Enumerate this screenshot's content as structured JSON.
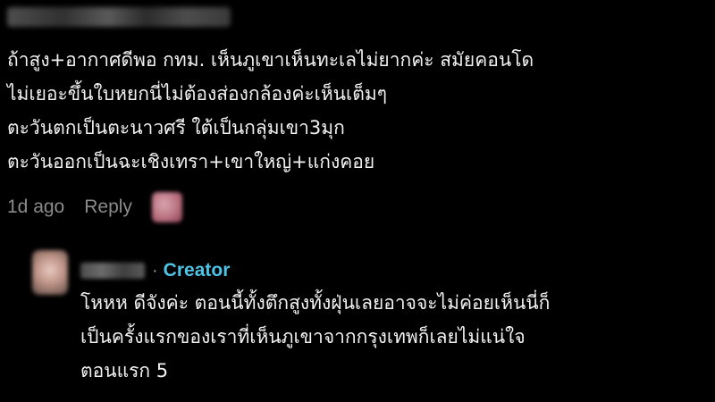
{
  "comment": {
    "lines": [
      "ถ้าสูง+อากาศดีพอ กทม. เห็นภูเขาเห็นทะเลไม่ยากค่ะ สมัยคอนโด",
      "ไม่เยอะขึ้นใบหยกนี่ไม่ต้องส่องกล้องค่ะเห็นเต็มๆ",
      "ตะวันตกเป็นตะนาวศรี ใต้เป็นกลุ่มเขา3มุก",
      "ตะวันออกเป็นฉะเชิงเทรา+เขาใหญ่+แก่งคอย"
    ],
    "timestamp": "1d ago",
    "reply_label": "Reply"
  },
  "reply": {
    "separator": "·",
    "badge": "Creator",
    "badge_color": "#4fc3e6",
    "lines": [
      "โหหห ดีจังค่ะ ตอนนี้ทั้งตึกสูงทั้งฝุ่นเลยอาจจะไม่ค่อยเห็นนี่ก็",
      "เป็นครั้งแรกของเราที่เห็นภูเขาจากกรุงเทพก็เลยไม่แน่ใจ",
      "ตอนแรก 5"
    ]
  }
}
